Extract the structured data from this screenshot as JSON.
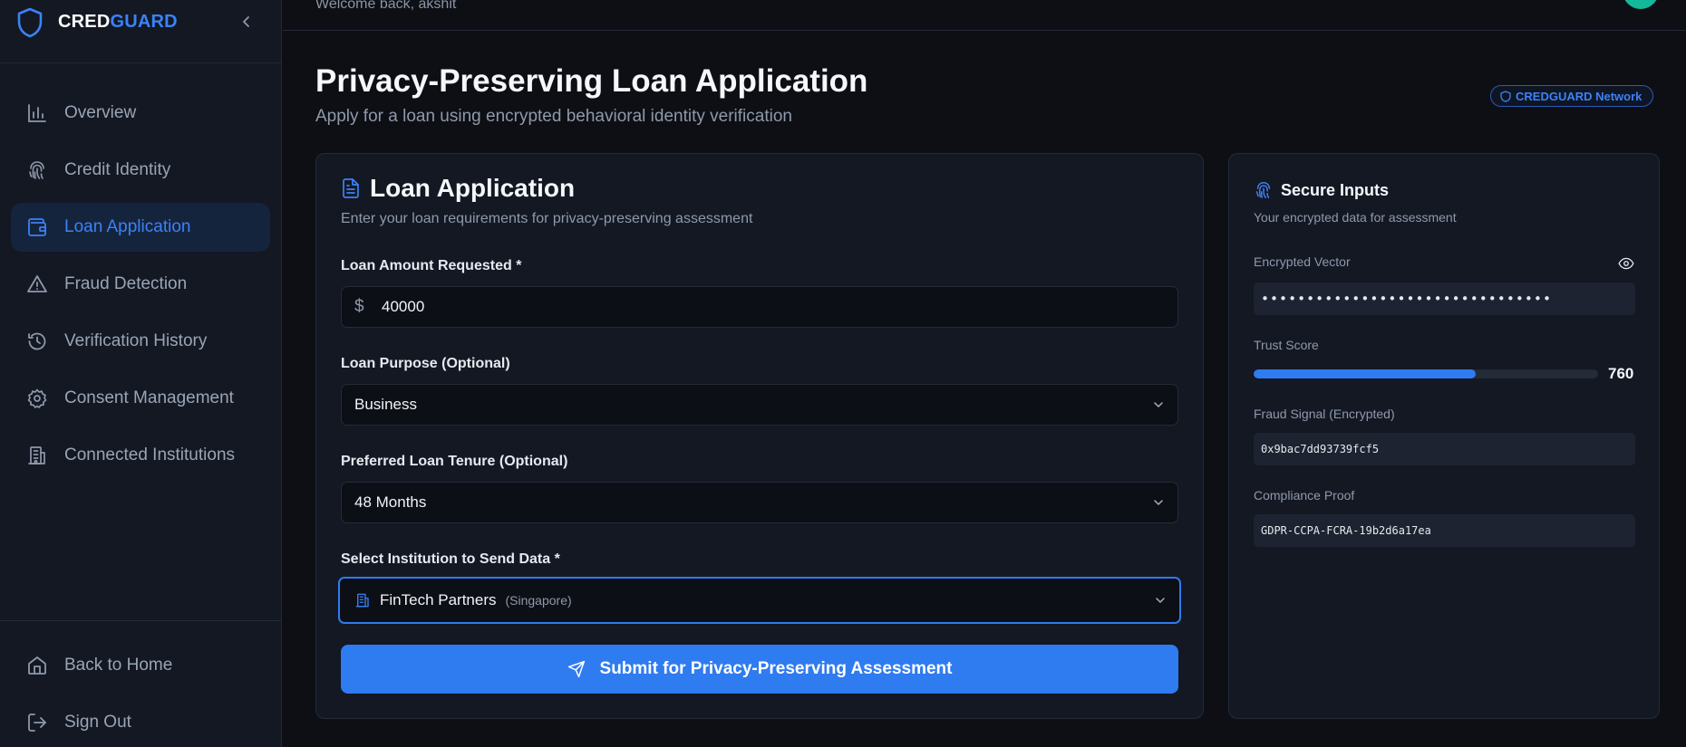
{
  "brand": {
    "name_part1": "CRED",
    "name_part2": "GUARD"
  },
  "sidebar": {
    "items": [
      {
        "label": "Overview",
        "icon": "bar-chart-icon",
        "active": false
      },
      {
        "label": "Credit Identity",
        "icon": "fingerprint-icon",
        "active": false
      },
      {
        "label": "Loan Application",
        "icon": "wallet-icon",
        "active": true
      },
      {
        "label": "Fraud Detection",
        "icon": "alert-triangle-icon",
        "active": false
      },
      {
        "label": "Verification History",
        "icon": "history-icon",
        "active": false
      },
      {
        "label": "Consent Management",
        "icon": "gear-icon",
        "active": false
      },
      {
        "label": "Connected Institutions",
        "icon": "building-icon",
        "active": false
      }
    ],
    "bottom": {
      "home_label": "Back to Home",
      "signout_label": "Sign Out"
    }
  },
  "topbar": {
    "welcome": "Welcome back, akshit"
  },
  "header": {
    "title": "Privacy-Preserving Loan Application",
    "subtitle": "Apply for a loan using encrypted behavioral identity verification",
    "network_badge": "CREDGUARD Network"
  },
  "loan_form": {
    "title": "Loan Application",
    "subtitle": "Enter your loan requirements for privacy-preserving assessment",
    "amount": {
      "label": "Loan Amount Requested *",
      "currency_symbol": "$",
      "value": "40000"
    },
    "purpose": {
      "label": "Loan Purpose (Optional)",
      "value": "Business"
    },
    "tenure": {
      "label": "Preferred Loan Tenure (Optional)",
      "value": "48 Months"
    },
    "institution": {
      "label": "Select Institution to Send Data *",
      "value": "FinTech Partners",
      "location": "(Singapore)"
    },
    "submit_label": "Submit for Privacy-Preserving Assessment"
  },
  "secure_inputs": {
    "title": "Secure Inputs",
    "subtitle": "Your encrypted data for assessment",
    "encrypted_vector": {
      "label": "Encrypted Vector",
      "value": "••••••••••••••••••••••••••••••••"
    },
    "trust_score": {
      "label": "Trust Score",
      "value": "760",
      "fill_fraction": 0.644
    },
    "fraud_signal": {
      "label": "Fraud Signal (Encrypted)",
      "value": "0x9bac7dd93739fcf5"
    },
    "compliance_proof": {
      "label": "Compliance Proof",
      "value": "GDPR-CCPA-FCRA-19b2d6a17ea"
    }
  },
  "colors": {
    "accent": "#3b82f6",
    "primary_button": "#2f7bf0",
    "avatar": "#14b89a",
    "background": "#0d0f14",
    "card": "#131823"
  }
}
